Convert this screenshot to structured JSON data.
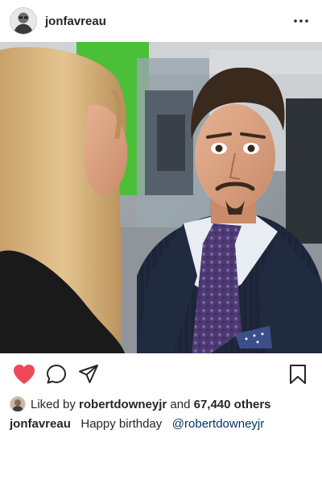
{
  "post": {
    "author": {
      "username": "jonfavreau",
      "avatar_icon": "profile-avatar"
    },
    "more_icon": "more-horizontal-icon",
    "photo": {
      "colors": {
        "hair": "#d6b27e",
        "suit": "#1c2538",
        "tie": "#4e3a72",
        "wall_green": "#4bbf38"
      }
    },
    "actions": {
      "like_icon": "heart-icon",
      "like_active": true,
      "like_color": "#ed4956",
      "comment_icon": "comment-icon",
      "share_icon": "send-icon",
      "save_icon": "bookmark-icon"
    },
    "likes": {
      "prefix": "Liked by",
      "user": "robertdowneyjr",
      "connector": "and",
      "count_text": "67,440 others"
    },
    "caption": {
      "username": "jonfavreau",
      "text": "Happy birthday",
      "mention": "@robertdowneyjr",
      "mention_color": "#003569"
    }
  }
}
